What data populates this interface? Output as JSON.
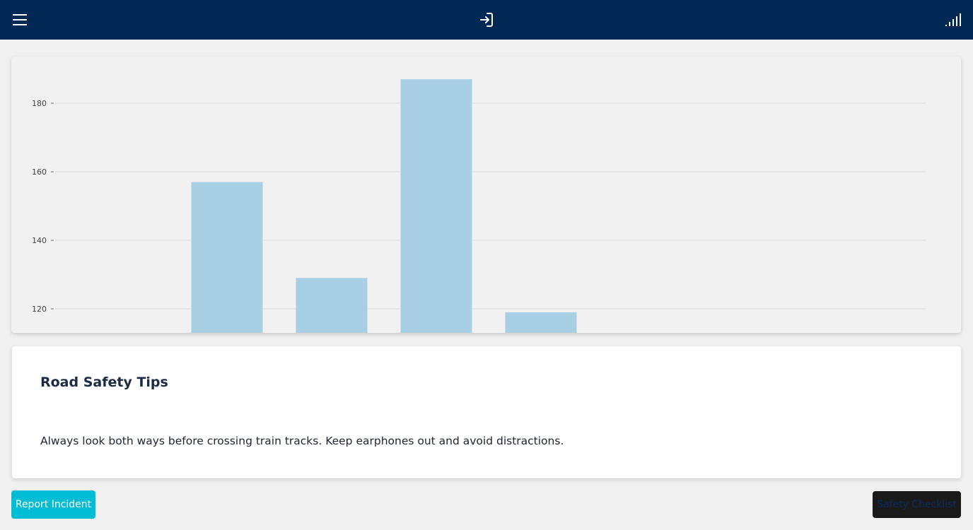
{
  "header": {
    "menu_icon": "hamburger-menu-icon",
    "login_icon": "login-arrow-icon",
    "signal_icon": "signal-strength-icon",
    "background_color": "#002855"
  },
  "chart_data": {
    "type": "bar",
    "categories": [
      "",
      "",
      "",
      "",
      "",
      "",
      "",
      ""
    ],
    "values": [
      null,
      157,
      129,
      187,
      119,
      null,
      null,
      null
    ],
    "y_ticks": [
      "120",
      "140",
      "160",
      "180"
    ],
    "ylim": [
      113,
      194
    ],
    "grid": true,
    "bar_color": "#a8cfe3",
    "title": "",
    "xlabel": "",
    "ylabel": ""
  },
  "tips": {
    "title": "Road Safety Tips",
    "text": "Always look both ways before crossing train tracks. Keep earphones out and avoid distractions."
  },
  "actions": {
    "report_label": "Report Incident",
    "report_color": "#00bcd4",
    "checklist_label": "Safety Checklist",
    "checklist_color": "#1a1a1a"
  }
}
